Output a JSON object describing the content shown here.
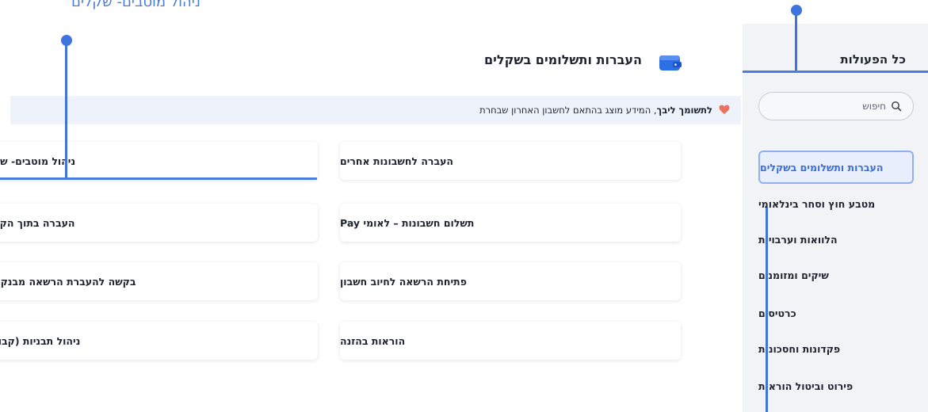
{
  "annotation": {
    "label": "ניהול מוטבים- שקלים"
  },
  "sidebar": {
    "title": "כל הפעולות",
    "search_placeholder": "חיפוש",
    "items": [
      {
        "label": "העברות ותשלומים בשקלים",
        "active": true
      },
      {
        "label": "מטבע חוץ וסחר בינלאומי"
      },
      {
        "label": "הלוואות וערבויות"
      },
      {
        "label": "שיקים ומזומנים"
      },
      {
        "label": "כרטיסים"
      },
      {
        "label": "פקדונות וחסכונות"
      },
      {
        "label": "פירוט וביטול הוראות"
      }
    ]
  },
  "main": {
    "title": "העברות ותשלומים בשקלים",
    "info": {
      "bold": "לתשומך ליבך",
      "text": ", המידע מוצג בהתאם לחשבון האחרון שבחרת"
    },
    "cards": [
      "העברה לחשבונות אחרים",
      "ניהול מוטבים- שקלים",
      "תשלום חשבונות – לאומי Pay",
      "העברה בתוך הקבוצה",
      "פתיחת הרשאה לחיוב חשבון",
      "בקשה להעברת הרשאה מבנק אחר",
      "הוראות בהזנה",
      "ניהול תבניות (קבוצות)"
    ]
  },
  "colors": {
    "accent": "#3f74df",
    "active_item_bg": "#e8eefb",
    "sidebar_bg": "#f2f3f6",
    "info_bg": "#eef2fb",
    "heart": "#e8735f"
  },
  "icons": {
    "search": "search-icon",
    "wallet": "wallet-icon",
    "heart": "heart-icon"
  }
}
